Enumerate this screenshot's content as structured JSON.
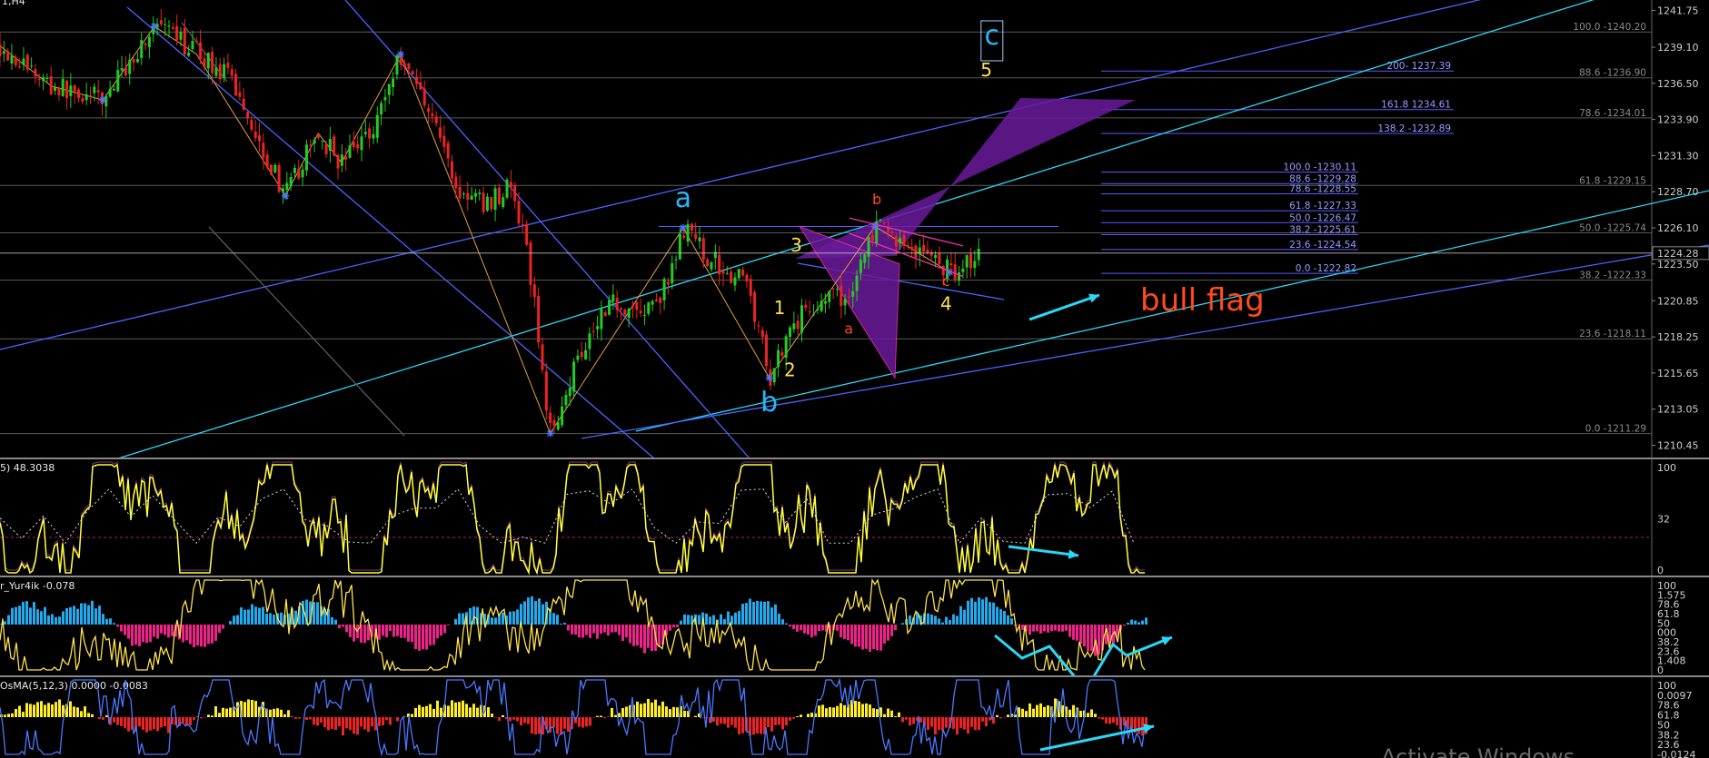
{
  "chart_data": [
    {
      "type": "candlestick",
      "panel": "price",
      "title": "",
      "price_axis": {
        "range": [
          1209.5,
          1242.5
        ],
        "ticks": [
          1241.75,
          1239.1,
          1236.5,
          1233.9,
          1231.3,
          1228.7,
          1226.1,
          1223.5,
          1220.85,
          1218.25,
          1215.65,
          1213.05,
          1210.45
        ],
        "tick_labels": [
          "1241.75",
          "1239.10",
          "1236.50",
          "1233.90",
          "1231.30",
          "1228.70",
          "1226.10",
          "1223.50",
          "1220.85",
          "1218.25",
          "1215.65",
          "1213.05",
          "1210.45"
        ]
      },
      "current_price": 1224.28,
      "current_price_label": "1224.28",
      "candle_colors": {
        "up": "#22cc22",
        "down": "#ee2222"
      },
      "close_path": [
        [
          0,
          1239.2
        ],
        [
          55,
          1236.3
        ],
        [
          110,
          1235.3
        ],
        [
          165,
          1240.6
        ],
        [
          210,
          1238.8
        ],
        [
          250,
          1236.5
        ],
        [
          270,
          1233.4
        ],
        [
          305,
          1228.4
        ],
        [
          340,
          1232.9
        ],
        [
          365,
          1230.8
        ],
        [
          400,
          1233.6
        ],
        [
          428,
          1238.6
        ],
        [
          460,
          1234.7
        ],
        [
          490,
          1228.6
        ],
        [
          520,
          1227.8
        ],
        [
          545,
          1229.2
        ],
        [
          565,
          1223.8
        ],
        [
          588,
          1211.3
        ],
        [
          620,
          1217.3
        ],
        [
          650,
          1220.9
        ],
        [
          690,
          1220.0
        ],
        [
          715,
          1222.1
        ],
        [
          730,
          1226.1
        ],
        [
          760,
          1223.8
        ],
        [
          800,
          1222.0
        ],
        [
          822,
          1215.3
        ],
        [
          845,
          1219.1
        ],
        [
          880,
          1221.1
        ],
        [
          905,
          1220.9
        ],
        [
          935,
          1226.2
        ],
        [
          965,
          1225.0
        ],
        [
          1000,
          1223.9
        ],
        [
          1015,
          1222.9
        ],
        [
          1030,
          1223.6
        ],
        [
          1050,
          1224.3
        ]
      ],
      "fib_levels_right": [
        {
          "label": "100.0 -1240.20",
          "value": 1240.2
        },
        {
          "label": "88.6 -1236.90",
          "value": 1236.9
        },
        {
          "label": "78.6 -1234.01",
          "value": 1234.01
        },
        {
          "label": "61.8 -1229.15",
          "value": 1229.15
        },
        {
          "label": "50.0 -1225.74",
          "value": 1225.74
        },
        {
          "label": "38.2 -1222.33",
          "value": 1222.33
        },
        {
          "label": "23.6 -1218.11",
          "value": 1218.11
        },
        {
          "label": "0.0 -1211.29",
          "value": 1211.29
        }
      ],
      "fib_extensions": [
        {
          "label": "200- 1237.39",
          "value": 1237.39
        },
        {
          "label": "161.8 1234.61",
          "value": 1234.61
        },
        {
          "label": "138.2 -1232.89",
          "value": 1232.89
        }
      ],
      "fib_retrace_small": [
        {
          "label": "100.0 -1230.11",
          "value": 1230.11
        },
        {
          "label": "88.6 -1229.28",
          "value": 1229.28
        },
        {
          "label": "78.6 -1228.55",
          "value": 1228.55
        },
        {
          "label": "61.8 -1227.33",
          "value": 1227.33
        },
        {
          "label": "50.0 -1226.47",
          "value": 1226.47
        },
        {
          "label": "38.2 -1225.61",
          "value": 1225.61
        },
        {
          "label": "23.6 -1224.54",
          "value": 1224.54
        },
        {
          "label": "0.0 -1222.82",
          "value": 1222.82
        }
      ],
      "wave_labels": [
        {
          "text": "a",
          "bar": 730,
          "price": 1227.6,
          "color": "#29b6f6",
          "size": "large"
        },
        {
          "text": "b",
          "bar": 822,
          "price": 1212.9,
          "color": "#29b6f6",
          "size": "large"
        },
        {
          "text": "c",
          "bar": 1060,
          "price": 1239.3,
          "color": "#29b6f6",
          "size": "large",
          "boxed": true
        },
        {
          "text": "1",
          "bar": 833,
          "price": 1219.9,
          "color": "#ffe24a",
          "size": "medium"
        },
        {
          "text": "2",
          "bar": 844,
          "price": 1215.4,
          "color": "#ffe24a",
          "size": "medium"
        },
        {
          "text": "3",
          "bar": 851,
          "price": 1224.4,
          "color": "#ffe24a",
          "size": "medium"
        },
        {
          "text": "4",
          "bar": 1011,
          "price": 1220.2,
          "color": "#ffe24a",
          "size": "medium"
        },
        {
          "text": "5",
          "bar": 1054,
          "price": 1237.0,
          "color": "#ffe24a",
          "size": "medium"
        },
        {
          "text": "a",
          "bar": 907,
          "price": 1218.5,
          "color": "#ff4a1a",
          "size": "small"
        },
        {
          "text": "b",
          "bar": 937,
          "price": 1227.8,
          "color": "#ff4a1a",
          "size": "small"
        },
        {
          "text": "c",
          "bar": 1011,
          "price": 1221.9,
          "color": "#ff4a1a",
          "size": "small"
        }
      ],
      "annotation": {
        "text": "bull flag",
        "color": "#ff4a1a"
      }
    },
    {
      "type": "line",
      "panel": "oscillator-1",
      "title": "5) 48.3038",
      "axis_labels": [
        "100",
        "32",
        "0"
      ],
      "line_color": "#ffff3a"
    },
    {
      "type": "histogram",
      "panel": "oscillator-2",
      "title": "r_Yur4ik -0.078",
      "axis_labels": [
        "100",
        "1.575",
        "78.6",
        "61.8",
        "50",
        "000",
        "38.2",
        "23.6",
        "1.408",
        "0"
      ],
      "bar_colors": {
        "positive": "#22aaee",
        "negative": "#ee2288"
      },
      "line_color": "#ffe24a"
    },
    {
      "type": "histogram",
      "panel": "oscillator-3",
      "title": "OsMA(5,12,3) 0.0000 -0.0083",
      "axis_labels": [
        "100",
        "0.0097",
        "78.6",
        "61.8",
        "50",
        "38.2",
        "23.6",
        "-0.0124"
      ],
      "bar_colors": {
        "positive": "#ffee22",
        "negative": "#ee2222"
      },
      "line_color": "#4a78ff"
    }
  ],
  "ui": {
    "top_left_stub": "1,H4",
    "watermark": "Activate Windows"
  },
  "colors": {
    "cyan": "#29d8f6",
    "blue": "#4a64ff",
    "purple": "#6a1a9a",
    "magenta": "#ee33aa",
    "orange_line": "#e0a040",
    "grid": "#3a3a3a"
  }
}
